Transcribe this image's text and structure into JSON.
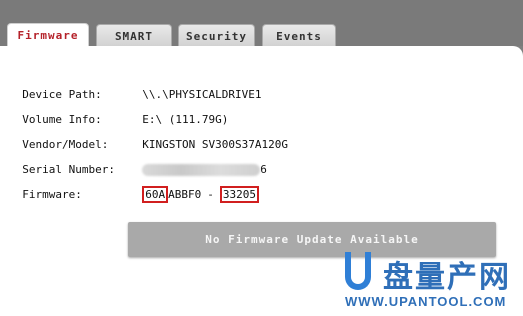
{
  "tabs": [
    {
      "label": "Firmware",
      "active": true
    },
    {
      "label": "SMART",
      "active": false
    },
    {
      "label": "Security",
      "active": false
    },
    {
      "label": "Events",
      "active": false
    }
  ],
  "info": {
    "device_path_label": "Device Path:",
    "device_path_value": "\\\\.\\PHYSICALDRIVE1",
    "volume_info_label": "Volume Info:",
    "volume_info_value": "E:\\ (111.79G)",
    "vendor_model_label": "Vendor/Model:",
    "vendor_model_value": "KINGSTON SV300S37A120G",
    "serial_label": "Serial Number:",
    "serial_visible_suffix": "6",
    "firmware_label": "Firmware:",
    "firmware_part1": "60A",
    "firmware_part2": "ABBF0",
    "firmware_sep": "-",
    "firmware_part3": "33205"
  },
  "update_button": {
    "label": "No Firmware Update Available"
  },
  "watermark": {
    "brand_cn": "盘量产网",
    "url": "WWW.UPANTOOL.COM"
  },
  "colors": {
    "accent": "#b5222a",
    "highlight_box": "#d11f1f",
    "button_bg": "#a9a9a9"
  }
}
